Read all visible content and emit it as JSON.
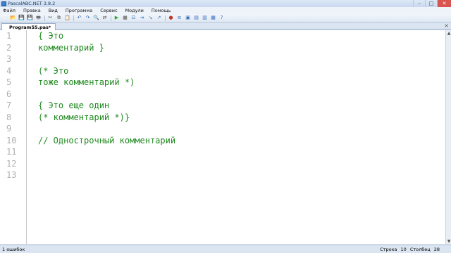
{
  "window": {
    "title": "PascalABC.NET 3.8.2",
    "controls": [
      "–",
      "□",
      "✕"
    ]
  },
  "menu": {
    "items": [
      "Файл",
      "Правка",
      "Вид",
      "Программа",
      "Сервис",
      "Модули",
      "Помощь"
    ]
  },
  "toolbar": {
    "buttons": [
      {
        "icon": "new-file-icon",
        "glyph": "🗋",
        "color": "#ffffff"
      },
      {
        "icon": "open-folder-icon",
        "glyph": "📂",
        "color": "#d9a43a"
      },
      {
        "icon": "save-icon",
        "glyph": "💾",
        "color": "#3a6fc0"
      },
      {
        "icon": "save-all-icon",
        "glyph": "💾",
        "color": "#3a6fc0"
      },
      {
        "icon": "print-icon",
        "glyph": "🖶",
        "color": "#555555"
      },
      {
        "icon": "cut-icon",
        "glyph": "✂",
        "color": "#555555"
      },
      {
        "icon": "copy-icon",
        "glyph": "⧉",
        "color": "#555555"
      },
      {
        "icon": "paste-icon",
        "glyph": "📋",
        "color": "#a07030"
      },
      {
        "icon": "undo-icon",
        "glyph": "↶",
        "color": "#2a5fa8"
      },
      {
        "icon": "redo-icon",
        "glyph": "↷",
        "color": "#2a5fa8"
      },
      {
        "icon": "find-icon",
        "glyph": "🔍",
        "color": "#555555"
      },
      {
        "icon": "replace-icon",
        "glyph": "⇄",
        "color": "#555555"
      },
      {
        "icon": "run-icon",
        "glyph": "▶",
        "color": "#2ea12e"
      },
      {
        "icon": "stop-icon",
        "glyph": "■",
        "color": "#888888"
      },
      {
        "icon": "debug-icon",
        "glyph": "⊡",
        "color": "#3a6fc0"
      },
      {
        "icon": "step-over-icon",
        "glyph": "⇥",
        "color": "#3a6fc0"
      },
      {
        "icon": "step-into-icon",
        "glyph": "↘",
        "color": "#3a6fc0"
      },
      {
        "icon": "step-out-icon",
        "glyph": "↗",
        "color": "#3a6fc0"
      },
      {
        "icon": "breakpoint-icon",
        "glyph": "●",
        "color": "#c0392b"
      },
      {
        "icon": "format-icon",
        "glyph": "≡",
        "color": "#3a6fc0"
      },
      {
        "icon": "toggle-panel-icon",
        "glyph": "▣",
        "color": "#3a6fc0"
      },
      {
        "icon": "output-window-icon",
        "glyph": "▤",
        "color": "#3a6fc0"
      },
      {
        "icon": "project-icon",
        "glyph": "▥",
        "color": "#3a6fc0"
      },
      {
        "icon": "settings-icon",
        "glyph": "▦",
        "color": "#3a6fc0"
      },
      {
        "icon": "help-icon",
        "glyph": "?",
        "color": "#3a6fc0"
      }
    ]
  },
  "tabs": [
    {
      "label": "Program55.pas*"
    }
  ],
  "editor": {
    "code_color": "#1f8a1f",
    "line_numbers": [
      "1",
      "2",
      "3",
      "4",
      "5",
      "6",
      "7",
      "8",
      "9",
      "10",
      "11",
      "12",
      "13"
    ],
    "lines": [
      "{ Это",
      "комментарий }",
      "",
      "(* Это",
      "тоже комментарий *)",
      "",
      "{ Это еще один",
      "(* комментарий *)}",
      "",
      "// Однострочный комментарий",
      "",
      "",
      ""
    ]
  },
  "status": {
    "errors": "1 ошибок",
    "row_label": "Строка",
    "row_value": "10",
    "col_label": "Столбец",
    "col_value": "28"
  }
}
